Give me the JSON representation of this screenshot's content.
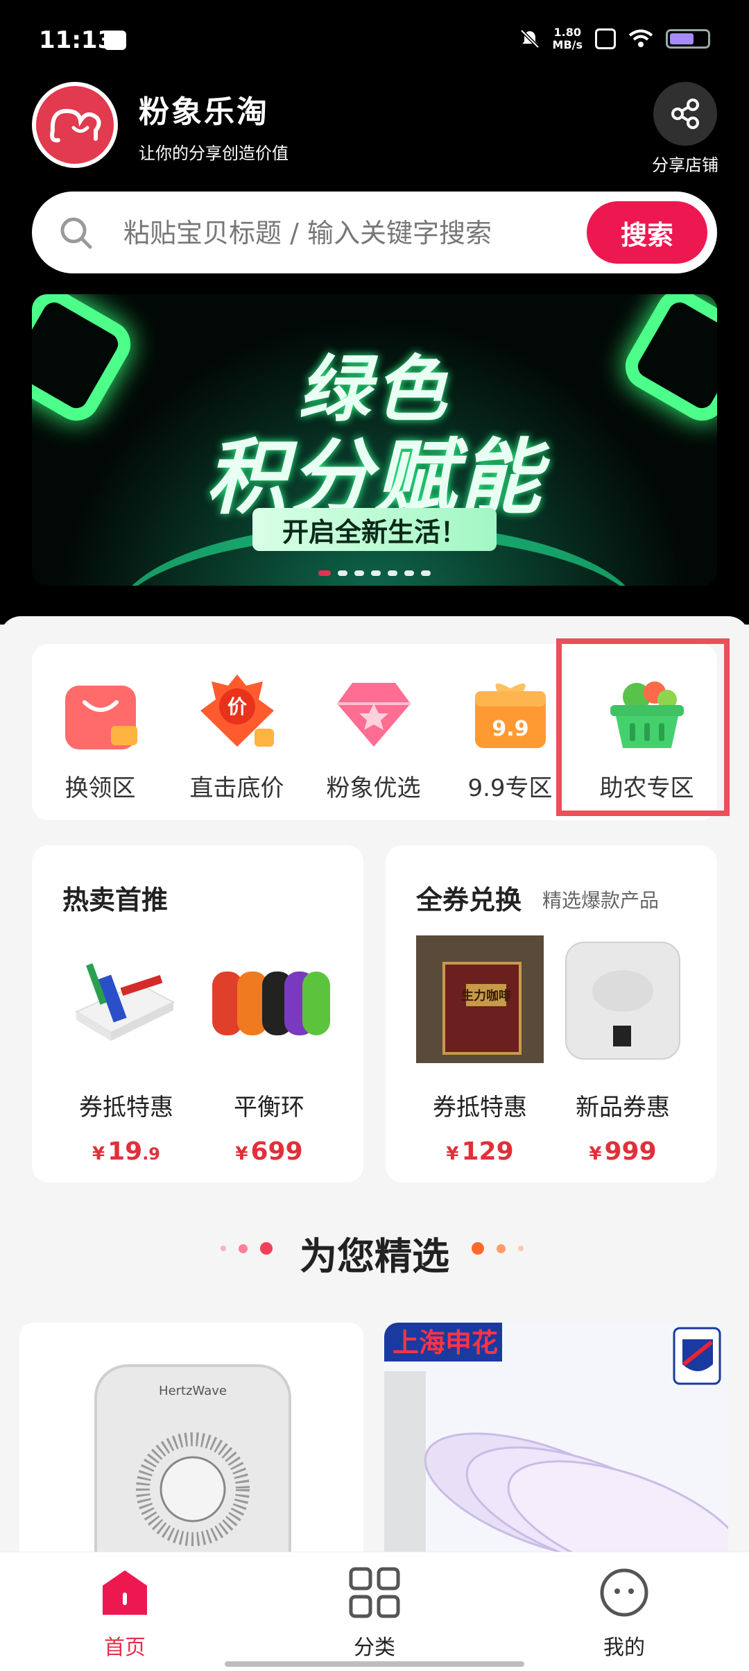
{
  "status_bar": {
    "time": "11:13",
    "net_speed_value": "1.80",
    "net_speed_unit": "MB/s"
  },
  "header": {
    "app_name": "粉象乐淘",
    "tagline": "让你的分享创造价值",
    "share_label": "分享店铺"
  },
  "search": {
    "placeholder": "粘贴宝贝标题 / 输入关键字搜索",
    "button_label": "搜索"
  },
  "banner": {
    "line1": "绿色",
    "line2": "积分赋能",
    "pill": "开启全新生活！",
    "page_count": 7,
    "active_index": 0
  },
  "categories": [
    {
      "label": "换领区",
      "icon": "shopping-bag-icon"
    },
    {
      "label": "直击底价",
      "icon": "price-tag-icon"
    },
    {
      "label": "粉象优选",
      "icon": "diamond-icon"
    },
    {
      "label": "9.9专区",
      "icon": "gift-box-icon"
    },
    {
      "label": "助农专区",
      "icon": "vegetable-basket-icon"
    }
  ],
  "cards": {
    "hot": {
      "title": "热卖首推",
      "products": [
        {
          "name": "券抵特惠",
          "currency": "¥",
          "price_int": "19",
          "price_dec": ".9"
        },
        {
          "name": "平衡环",
          "currency": "¥",
          "price_int": "699",
          "price_dec": ""
        }
      ]
    },
    "coupon": {
      "title": "全券兑换",
      "subtitle": "精选爆款产品",
      "products": [
        {
          "name": "券抵特惠",
          "currency": "¥",
          "price_int": "129",
          "price_dec": "",
          "img_text": "生力咖啡"
        },
        {
          "name": "新品券惠",
          "currency": "¥",
          "price_int": "999",
          "price_dec": ""
        }
      ]
    }
  },
  "section": {
    "title": "为您精选"
  },
  "feed": {
    "item1_brand": "HertzWave",
    "item2_brand": "上海申花"
  },
  "bottom_nav": [
    {
      "label": "首页",
      "icon": "home-icon",
      "active": true
    },
    {
      "label": "分类",
      "icon": "grid-icon",
      "active": false
    },
    {
      "label": "我的",
      "icon": "profile-icon",
      "active": false
    }
  ],
  "colors": {
    "accent": "#ee1850",
    "price": "#e0303a",
    "highlight_box": "#e9505a"
  }
}
